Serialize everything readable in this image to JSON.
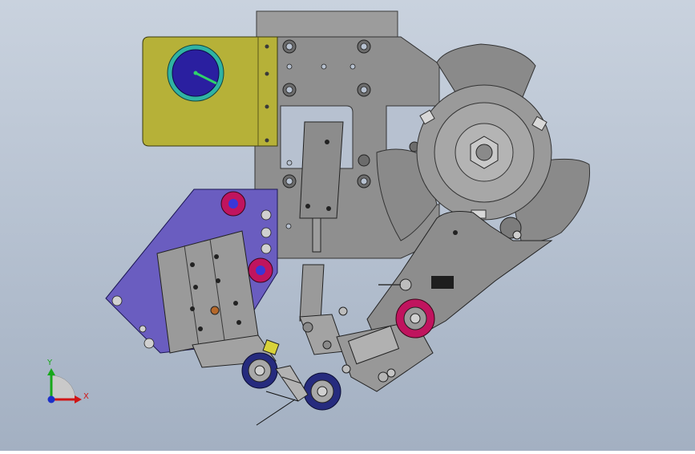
{
  "viewport": {
    "background_top": "#c9d2de",
    "background_bottom": "#a3b0c2"
  },
  "triad": {
    "x_label": "X",
    "y_label": "Y",
    "x_color": "#d01515",
    "y_color": "#17a81a",
    "z_color": "#1b2fc9"
  },
  "colors": {
    "plate_gray": "#8c8c8c",
    "olive_plate": "#b6b138",
    "purple_plate": "#6a5dc0",
    "dial_blue": "#2a1fa0",
    "dial_ring": "#2fb3a3",
    "magenta_part": "#c0145e",
    "navy_wheel": "#262b7e",
    "yellow_part": "#d8d23a"
  }
}
